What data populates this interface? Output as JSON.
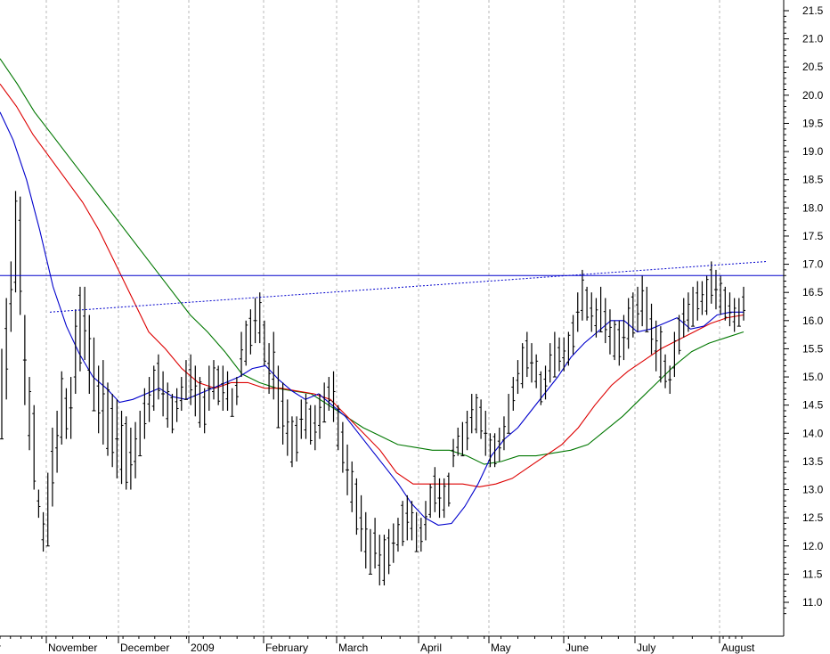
{
  "chart_data": {
    "type": "ohlc",
    "title": "",
    "xlabel": "",
    "ylabel": "",
    "ylim": [
      10.5,
      21.6
    ],
    "y_ticks": [
      "21.5",
      "21.0",
      "20.5",
      "20.0",
      "19.5",
      "19.0",
      "18.5",
      "18.0",
      "17.5",
      "17.0",
      "16.5",
      "16.0",
      "15.5",
      "15.0",
      "14.5",
      "14.0",
      "13.5",
      "13.0",
      "12.5",
      "12.0",
      "11.5",
      "11.0"
    ],
    "x_labels": [
      "r",
      "November",
      "December",
      "2009",
      "February",
      "March",
      "April",
      "May",
      "June",
      "July",
      "August"
    ],
    "grid": "vertical dashed at month starts",
    "colors": {
      "price": "#000000",
      "ma_fast": "#0000cc",
      "ma_mid": "#dd0000",
      "ma_slow": "#007700",
      "resistance": "#0000cc"
    },
    "resistance_level": 16.8,
    "trendline": {
      "from_day": 56,
      "from_value": 16.15,
      "to_day": 862,
      "to_value": 17.05
    },
    "bars_high": [
      15.5,
      16.4,
      17.05,
      18.3,
      18.2,
      16.1,
      15.0,
      14.5,
      13.0,
      12.6,
      13.3,
      14.1,
      14.4,
      15.1,
      14.8,
      15.0,
      16.2,
      16.6,
      16.6,
      16.1,
      15.7,
      15.2,
      15.3,
      14.9,
      14.7,
      14.6,
      14.4,
      14.3,
      14.1,
      14.2,
      14.4,
      14.8,
      15.0,
      15.2,
      15.4,
      15.1,
      14.9,
      14.7,
      14.8,
      15.0,
      15.3,
      15.4,
      15.2,
      15.0,
      14.8,
      15.2,
      15.3,
      15.2,
      15.2,
      15.1,
      14.8,
      15.0,
      15.8,
      16.0,
      16.2,
      16.4,
      16.5,
      16.0,
      15.6,
      15.8,
      15.2,
      14.9,
      14.6,
      14.3,
      14.3,
      14.6,
      14.7,
      14.5,
      14.5,
      14.7,
      14.9,
      15.0,
      15.1,
      14.5,
      14.2,
      13.8,
      13.5,
      13.2,
      12.9,
      12.6,
      12.3,
      12.5,
      12.2,
      12.2,
      12.3,
      12.4,
      12.5,
      12.8,
      12.9,
      12.8,
      12.6,
      12.5,
      12.8,
      13.1,
      13.4,
      13.2,
      13.2,
      13.3,
      13.9,
      14.1,
      14.2,
      14.4,
      14.7,
      14.7,
      14.6,
      14.4,
      14.0,
      14.0,
      14.1,
      14.3,
      14.7,
      15.0,
      15.3,
      15.6,
      15.8,
      15.6,
      15.4,
      15.1,
      15.2,
      15.6,
      15.8,
      15.7,
      15.7,
      15.8,
      16.1,
      16.5,
      16.9,
      16.6,
      16.5,
      16.4,
      16.6,
      16.4,
      16.2,
      16.0,
      16.0,
      16.1,
      16.4,
      16.5,
      16.6,
      16.8,
      16.6,
      16.3,
      16.0,
      15.9,
      15.4,
      15.2,
      15.8,
      16.1,
      16.4,
      16.5,
      16.6,
      16.7,
      16.7,
      16.8,
      17.05,
      16.9,
      16.8,
      16.6,
      16.5,
      16.4,
      16.4,
      16.6
    ],
    "bars_low": [
      13.9,
      14.6,
      15.8,
      16.5,
      16.1,
      14.5,
      13.7,
      13.0,
      12.5,
      11.9,
      12.0,
      12.7,
      13.3,
      13.8,
      13.9,
      13.9,
      14.7,
      15.1,
      15.3,
      14.7,
      14.4,
      14.0,
      13.8,
      13.6,
      13.4,
      13.2,
      13.1,
      13.0,
      13.0,
      13.2,
      13.6,
      13.9,
      14.2,
      14.4,
      14.6,
      14.3,
      14.1,
      14.0,
      14.2,
      14.4,
      14.6,
      14.5,
      14.3,
      14.1,
      14.0,
      14.4,
      14.6,
      14.5,
      14.4,
      14.4,
      14.3,
      14.5,
      15.0,
      15.2,
      15.4,
      15.6,
      15.6,
      15.2,
      14.7,
      14.6,
      14.1,
      13.8,
      13.6,
      13.4,
      13.5,
      13.9,
      13.9,
      13.8,
      13.7,
      13.9,
      14.2,
      14.4,
      14.2,
      13.7,
      13.3,
      12.9,
      12.6,
      12.2,
      11.9,
      11.6,
      11.5,
      11.6,
      11.3,
      11.3,
      11.5,
      11.7,
      11.9,
      12.0,
      12.1,
      12.1,
      11.9,
      11.9,
      12.1,
      12.5,
      12.6,
      12.5,
      12.5,
      12.7,
      13.4,
      13.6,
      13.6,
      13.7,
      14.0,
      14.0,
      13.9,
      13.6,
      13.4,
      13.4,
      13.5,
      13.7,
      14.0,
      14.4,
      14.7,
      14.8,
      15.0,
      14.9,
      14.8,
      14.5,
      14.6,
      14.9,
      15.0,
      15.1,
      15.1,
      15.2,
      15.4,
      15.8,
      16.0,
      16.0,
      15.8,
      15.7,
      15.8,
      15.6,
      15.4,
      15.3,
      15.2,
      15.3,
      15.5,
      15.7,
      15.8,
      15.9,
      15.8,
      15.4,
      15.1,
      14.9,
      14.8,
      14.7,
      15.0,
      15.4,
      15.7,
      15.8,
      15.9,
      16.0,
      16.1,
      16.1,
      16.3,
      16.2,
      16.1,
      16.0,
      15.9,
      15.8,
      15.9,
      16.0
    ],
    "ma_fast": [
      19.7,
      19.2,
      18.5,
      17.6,
      16.6,
      15.9,
      15.4,
      15.0,
      14.8,
      14.55,
      14.6,
      14.7,
      14.8,
      14.65,
      14.6,
      14.7,
      14.8,
      14.9,
      15.0,
      15.15,
      15.2,
      14.95,
      14.75,
      14.6,
      14.7,
      14.5,
      14.3,
      14.0,
      13.7,
      13.4,
      13.1,
      12.75,
      12.5,
      12.37,
      12.4,
      12.7,
      13.1,
      13.6,
      13.9,
      14.1,
      14.4,
      14.7,
      15.0,
      15.35,
      15.6,
      15.8,
      16.0,
      16.0,
      15.8,
      15.85,
      15.95,
      16.05,
      15.85,
      15.9,
      16.1,
      16.15,
      16.15
    ],
    "ma_mid": [
      20.2,
      19.8,
      19.3,
      18.9,
      18.5,
      18.1,
      17.6,
      17.0,
      16.4,
      15.8,
      15.5,
      15.15,
      14.9,
      14.8,
      14.9,
      14.9,
      14.8,
      14.8,
      14.75,
      14.7,
      14.6,
      14.3,
      14.0,
      13.7,
      13.3,
      13.1,
      13.1,
      13.1,
      13.1,
      13.05,
      13.1,
      13.2,
      13.4,
      13.6,
      13.8,
      14.1,
      14.5,
      14.85,
      15.1,
      15.3,
      15.5,
      15.65,
      15.8,
      15.95,
      16.05,
      16.1
    ],
    "ma_slow": [
      20.65,
      20.2,
      19.7,
      19.3,
      18.9,
      18.5,
      18.1,
      17.7,
      17.3,
      16.9,
      16.5,
      16.1,
      15.8,
      15.45,
      15.05,
      14.9,
      14.8,
      14.75,
      14.7,
      14.5,
      14.3,
      14.1,
      13.95,
      13.8,
      13.75,
      13.7,
      13.7,
      13.6,
      13.45,
      13.5,
      13.6,
      13.6,
      13.65,
      13.7,
      13.8,
      14.05,
      14.3,
      14.6,
      14.9,
      15.2,
      15.45,
      15.6,
      15.7,
      15.8
    ]
  }
}
